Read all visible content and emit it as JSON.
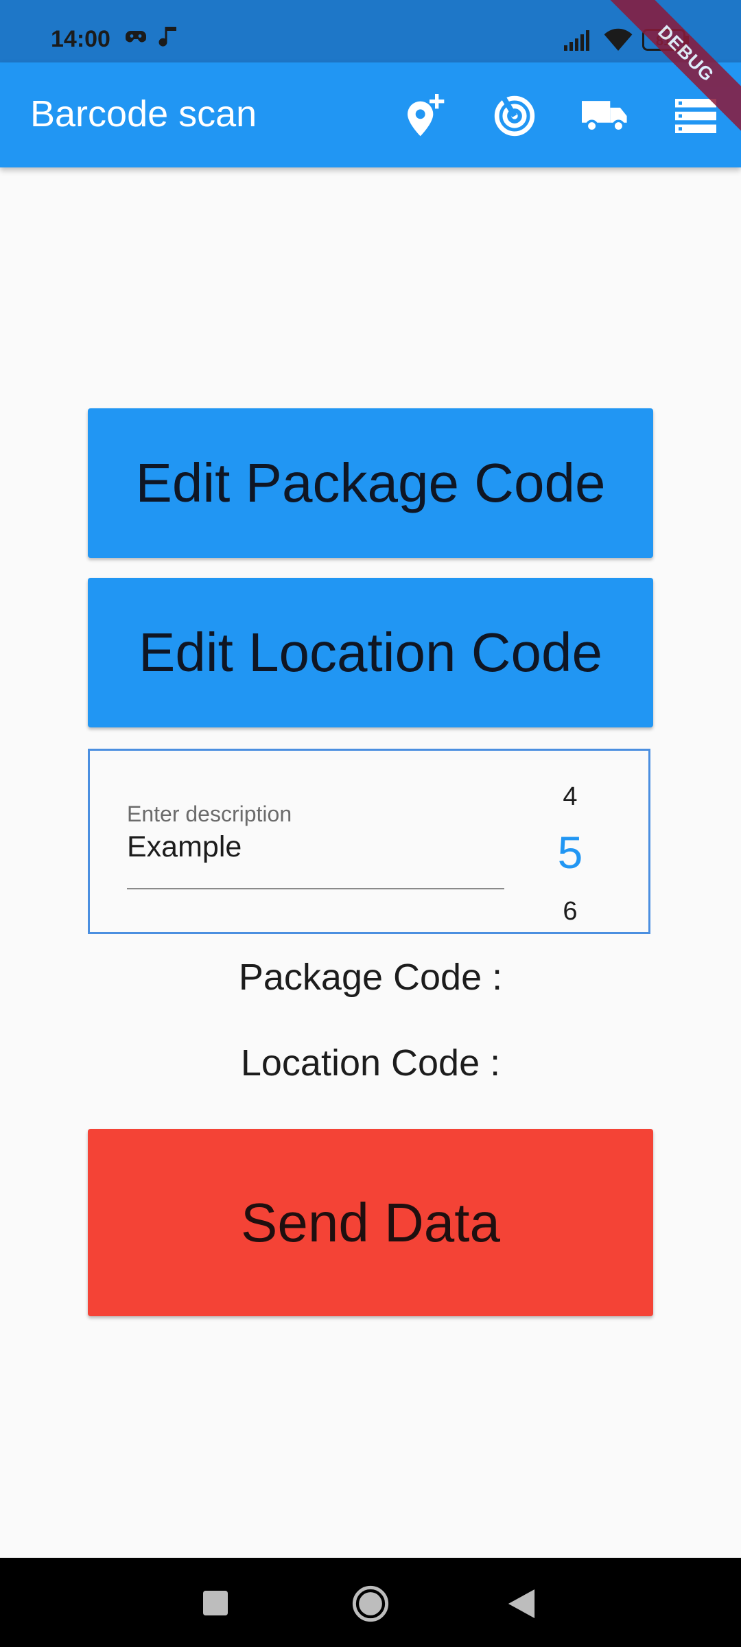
{
  "status_bar": {
    "time": "14:00",
    "battery": "81"
  },
  "app_bar": {
    "title": "Barcode scan",
    "icons": [
      "add-location-icon",
      "radar-icon",
      "truck-icon",
      "list-icon"
    ]
  },
  "debug_banner": "DEBUG",
  "buttons": {
    "edit_package": "Edit Package Code",
    "edit_location": "Edit Location Code",
    "send": "Send Data"
  },
  "description": {
    "label": "Enter description",
    "value": "Example"
  },
  "number_picker": {
    "previous": "4",
    "selected": "5",
    "next": "6"
  },
  "info": {
    "package_code": "Package Code :",
    "location_code": "Location Code :"
  },
  "colors": {
    "app_bar": "#2196f3",
    "status_bar": "#1e77c8",
    "primary_button": "#2196f3",
    "send_button": "#f44336",
    "card_border": "#4b8fe0"
  }
}
